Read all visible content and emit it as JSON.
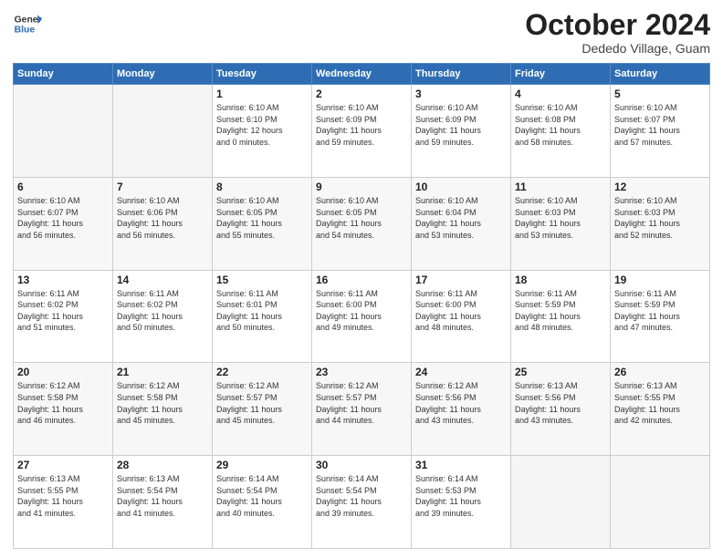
{
  "header": {
    "logo_line1": "General",
    "logo_line2": "Blue",
    "month": "October 2024",
    "location": "Dededo Village, Guam"
  },
  "weekdays": [
    "Sunday",
    "Monday",
    "Tuesday",
    "Wednesday",
    "Thursday",
    "Friday",
    "Saturday"
  ],
  "weeks": [
    [
      {
        "day": "",
        "info": ""
      },
      {
        "day": "",
        "info": ""
      },
      {
        "day": "1",
        "info": "Sunrise: 6:10 AM\nSunset: 6:10 PM\nDaylight: 12 hours\nand 0 minutes."
      },
      {
        "day": "2",
        "info": "Sunrise: 6:10 AM\nSunset: 6:09 PM\nDaylight: 11 hours\nand 59 minutes."
      },
      {
        "day": "3",
        "info": "Sunrise: 6:10 AM\nSunset: 6:09 PM\nDaylight: 11 hours\nand 59 minutes."
      },
      {
        "day": "4",
        "info": "Sunrise: 6:10 AM\nSunset: 6:08 PM\nDaylight: 11 hours\nand 58 minutes."
      },
      {
        "day": "5",
        "info": "Sunrise: 6:10 AM\nSunset: 6:07 PM\nDaylight: 11 hours\nand 57 minutes."
      }
    ],
    [
      {
        "day": "6",
        "info": "Sunrise: 6:10 AM\nSunset: 6:07 PM\nDaylight: 11 hours\nand 56 minutes."
      },
      {
        "day": "7",
        "info": "Sunrise: 6:10 AM\nSunset: 6:06 PM\nDaylight: 11 hours\nand 56 minutes."
      },
      {
        "day": "8",
        "info": "Sunrise: 6:10 AM\nSunset: 6:05 PM\nDaylight: 11 hours\nand 55 minutes."
      },
      {
        "day": "9",
        "info": "Sunrise: 6:10 AM\nSunset: 6:05 PM\nDaylight: 11 hours\nand 54 minutes."
      },
      {
        "day": "10",
        "info": "Sunrise: 6:10 AM\nSunset: 6:04 PM\nDaylight: 11 hours\nand 53 minutes."
      },
      {
        "day": "11",
        "info": "Sunrise: 6:10 AM\nSunset: 6:03 PM\nDaylight: 11 hours\nand 53 minutes."
      },
      {
        "day": "12",
        "info": "Sunrise: 6:10 AM\nSunset: 6:03 PM\nDaylight: 11 hours\nand 52 minutes."
      }
    ],
    [
      {
        "day": "13",
        "info": "Sunrise: 6:11 AM\nSunset: 6:02 PM\nDaylight: 11 hours\nand 51 minutes."
      },
      {
        "day": "14",
        "info": "Sunrise: 6:11 AM\nSunset: 6:02 PM\nDaylight: 11 hours\nand 50 minutes."
      },
      {
        "day": "15",
        "info": "Sunrise: 6:11 AM\nSunset: 6:01 PM\nDaylight: 11 hours\nand 50 minutes."
      },
      {
        "day": "16",
        "info": "Sunrise: 6:11 AM\nSunset: 6:00 PM\nDaylight: 11 hours\nand 49 minutes."
      },
      {
        "day": "17",
        "info": "Sunrise: 6:11 AM\nSunset: 6:00 PM\nDaylight: 11 hours\nand 48 minutes."
      },
      {
        "day": "18",
        "info": "Sunrise: 6:11 AM\nSunset: 5:59 PM\nDaylight: 11 hours\nand 48 minutes."
      },
      {
        "day": "19",
        "info": "Sunrise: 6:11 AM\nSunset: 5:59 PM\nDaylight: 11 hours\nand 47 minutes."
      }
    ],
    [
      {
        "day": "20",
        "info": "Sunrise: 6:12 AM\nSunset: 5:58 PM\nDaylight: 11 hours\nand 46 minutes."
      },
      {
        "day": "21",
        "info": "Sunrise: 6:12 AM\nSunset: 5:58 PM\nDaylight: 11 hours\nand 45 minutes."
      },
      {
        "day": "22",
        "info": "Sunrise: 6:12 AM\nSunset: 5:57 PM\nDaylight: 11 hours\nand 45 minutes."
      },
      {
        "day": "23",
        "info": "Sunrise: 6:12 AM\nSunset: 5:57 PM\nDaylight: 11 hours\nand 44 minutes."
      },
      {
        "day": "24",
        "info": "Sunrise: 6:12 AM\nSunset: 5:56 PM\nDaylight: 11 hours\nand 43 minutes."
      },
      {
        "day": "25",
        "info": "Sunrise: 6:13 AM\nSunset: 5:56 PM\nDaylight: 11 hours\nand 43 minutes."
      },
      {
        "day": "26",
        "info": "Sunrise: 6:13 AM\nSunset: 5:55 PM\nDaylight: 11 hours\nand 42 minutes."
      }
    ],
    [
      {
        "day": "27",
        "info": "Sunrise: 6:13 AM\nSunset: 5:55 PM\nDaylight: 11 hours\nand 41 minutes."
      },
      {
        "day": "28",
        "info": "Sunrise: 6:13 AM\nSunset: 5:54 PM\nDaylight: 11 hours\nand 41 minutes."
      },
      {
        "day": "29",
        "info": "Sunrise: 6:14 AM\nSunset: 5:54 PM\nDaylight: 11 hours\nand 40 minutes."
      },
      {
        "day": "30",
        "info": "Sunrise: 6:14 AM\nSunset: 5:54 PM\nDaylight: 11 hours\nand 39 minutes."
      },
      {
        "day": "31",
        "info": "Sunrise: 6:14 AM\nSunset: 5:53 PM\nDaylight: 11 hours\nand 39 minutes."
      },
      {
        "day": "",
        "info": ""
      },
      {
        "day": "",
        "info": ""
      }
    ]
  ]
}
